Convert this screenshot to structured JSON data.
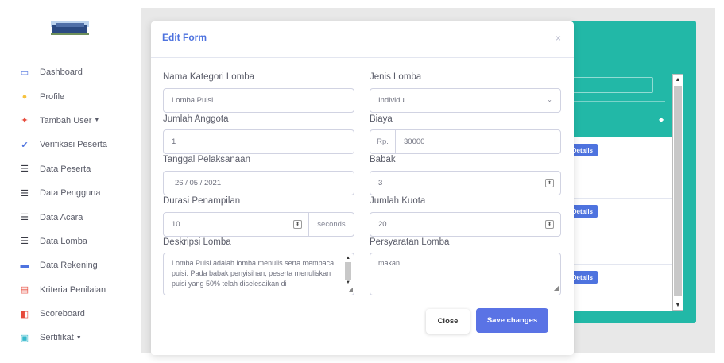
{
  "sidebar": {
    "items": [
      {
        "label": "Dashboard",
        "icon": "monitor-icon",
        "glyph": "▭",
        "color": "#4e73df",
        "caret": ""
      },
      {
        "label": "Profile",
        "icon": "user-icon",
        "glyph": "●",
        "color": "#f6c23e",
        "caret": ""
      },
      {
        "label": "Tambah User",
        "icon": "plus-icon",
        "glyph": "✦",
        "color": "#e74a3b",
        "caret": "▼"
      },
      {
        "label": "Verifikasi Peserta",
        "icon": "check-icon",
        "glyph": "✔",
        "color": "#4e73df",
        "caret": ""
      },
      {
        "label": "Data Peserta",
        "icon": "list-icon",
        "glyph": "☰",
        "color": "#3a3b45",
        "caret": ""
      },
      {
        "label": "Data Pengguna",
        "icon": "list-icon",
        "glyph": "☰",
        "color": "#3a3b45",
        "caret": ""
      },
      {
        "label": "Data Acara",
        "icon": "list-icon",
        "glyph": "☰",
        "color": "#3a3b45",
        "caret": ""
      },
      {
        "label": "Data Lomba",
        "icon": "list-icon",
        "glyph": "☰",
        "color": "#3a3b45",
        "caret": ""
      },
      {
        "label": "Data Rekening",
        "icon": "credit-card-icon",
        "glyph": "▬",
        "color": "#4e73df",
        "caret": ""
      },
      {
        "label": "Kriteria Penilaian",
        "icon": "clipboard-icon",
        "glyph": "▤",
        "color": "#e74a3b",
        "caret": ""
      },
      {
        "label": "Scoreboard",
        "icon": "scoreboard-icon",
        "glyph": "◧",
        "color": "#e74a3b",
        "caret": ""
      },
      {
        "label": "Sertifikat",
        "icon": "certificate-icon",
        "glyph": "▣",
        "color": "#36b9cc",
        "caret": "▼"
      }
    ]
  },
  "background": {
    "details_label": "Details"
  },
  "modal": {
    "title": "Edit Form",
    "close_symbol": "×",
    "nama_kategori": {
      "label": "Nama Kategori Lomba",
      "value": "Lomba Puisi"
    },
    "jenis_lomba": {
      "label": "Jenis Lomba",
      "value": "Individu"
    },
    "jumlah_anggota": {
      "label": "Jumlah Anggota",
      "value": "1"
    },
    "biaya": {
      "label": "Biaya",
      "prefix": "Rp.",
      "value": "30000"
    },
    "tanggal": {
      "label": "Tanggal Pelaksanaan",
      "value": "26 / 05 / 2021"
    },
    "babak": {
      "label": "Babak",
      "value": "3"
    },
    "durasi": {
      "label": "Durasi Penampilan",
      "value": "10",
      "suffix": "seconds"
    },
    "kuota": {
      "label": "Jumlah Kuota",
      "value": "20"
    },
    "deskripsi": {
      "label": "Deskripsi Lomba",
      "value": "Lomba Puisi adalah lomba menulis serta membaca puisi. Pada babak penyisihan, peserta menuliskan puisi yang 50% telah diselesaikan di"
    },
    "persyaratan": {
      "label": "Persyaratan Lomba",
      "value": "makan"
    },
    "close_button": "Close",
    "save_button": "Save changes"
  },
  "colors": {
    "accent": "#4e73df",
    "card": "#22b8a7",
    "save": "#5a73e5"
  }
}
